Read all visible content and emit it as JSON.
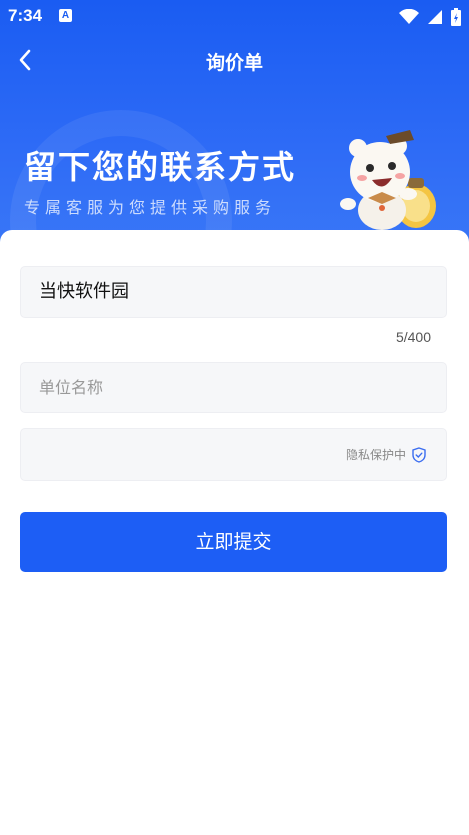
{
  "status_bar": {
    "time": "7:34",
    "notif_badge": "A"
  },
  "nav": {
    "title": "询价单",
    "back_icon": "chevron-left-icon"
  },
  "hero": {
    "headline": "留下您的联系方式",
    "subheadline": "专属客服为您提供采购服务"
  },
  "form": {
    "company_field": {
      "value": "当快软件园"
    },
    "char_counter": "5/400",
    "unit_name_field": {
      "placeholder": "单位名称"
    },
    "phone_field": {
      "value": "",
      "privacy_label": "隐私保护中",
      "privacy_icon": "shield-check-icon"
    },
    "submit_label": "立即提交"
  },
  "colors": {
    "primary": "#1d5ef5",
    "field_bg": "#f6f7f9"
  }
}
